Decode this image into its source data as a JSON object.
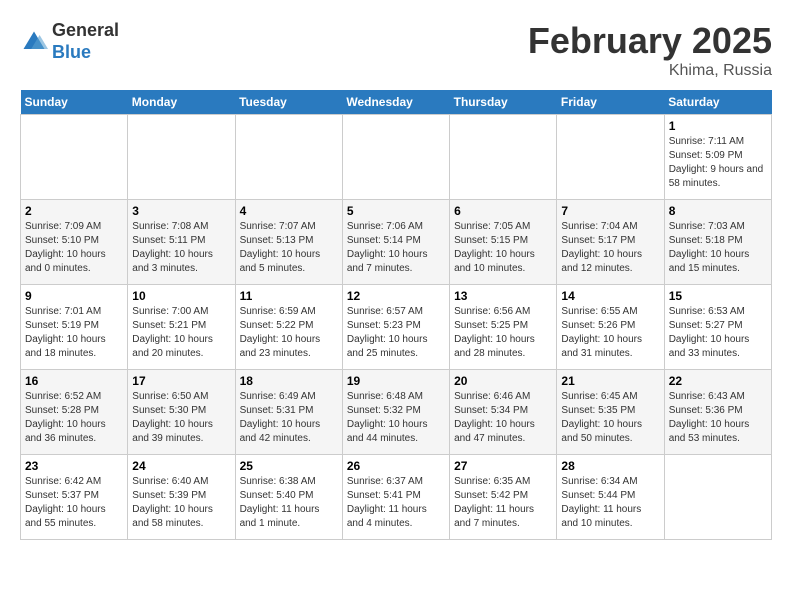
{
  "header": {
    "logo_general": "General",
    "logo_blue": "Blue",
    "title": "February 2025",
    "subtitle": "Khima, Russia"
  },
  "days_of_week": [
    "Sunday",
    "Monday",
    "Tuesday",
    "Wednesday",
    "Thursday",
    "Friday",
    "Saturday"
  ],
  "weeks": [
    [
      {
        "day": "",
        "info": ""
      },
      {
        "day": "",
        "info": ""
      },
      {
        "day": "",
        "info": ""
      },
      {
        "day": "",
        "info": ""
      },
      {
        "day": "",
        "info": ""
      },
      {
        "day": "",
        "info": ""
      },
      {
        "day": "1",
        "info": "Sunrise: 7:11 AM\nSunset: 5:09 PM\nDaylight: 9 hours and 58 minutes."
      }
    ],
    [
      {
        "day": "2",
        "info": "Sunrise: 7:09 AM\nSunset: 5:10 PM\nDaylight: 10 hours and 0 minutes."
      },
      {
        "day": "3",
        "info": "Sunrise: 7:08 AM\nSunset: 5:11 PM\nDaylight: 10 hours and 3 minutes."
      },
      {
        "day": "4",
        "info": "Sunrise: 7:07 AM\nSunset: 5:13 PM\nDaylight: 10 hours and 5 minutes."
      },
      {
        "day": "5",
        "info": "Sunrise: 7:06 AM\nSunset: 5:14 PM\nDaylight: 10 hours and 7 minutes."
      },
      {
        "day": "6",
        "info": "Sunrise: 7:05 AM\nSunset: 5:15 PM\nDaylight: 10 hours and 10 minutes."
      },
      {
        "day": "7",
        "info": "Sunrise: 7:04 AM\nSunset: 5:17 PM\nDaylight: 10 hours and 12 minutes."
      },
      {
        "day": "8",
        "info": "Sunrise: 7:03 AM\nSunset: 5:18 PM\nDaylight: 10 hours and 15 minutes."
      }
    ],
    [
      {
        "day": "9",
        "info": "Sunrise: 7:01 AM\nSunset: 5:19 PM\nDaylight: 10 hours and 18 minutes."
      },
      {
        "day": "10",
        "info": "Sunrise: 7:00 AM\nSunset: 5:21 PM\nDaylight: 10 hours and 20 minutes."
      },
      {
        "day": "11",
        "info": "Sunrise: 6:59 AM\nSunset: 5:22 PM\nDaylight: 10 hours and 23 minutes."
      },
      {
        "day": "12",
        "info": "Sunrise: 6:57 AM\nSunset: 5:23 PM\nDaylight: 10 hours and 25 minutes."
      },
      {
        "day": "13",
        "info": "Sunrise: 6:56 AM\nSunset: 5:25 PM\nDaylight: 10 hours and 28 minutes."
      },
      {
        "day": "14",
        "info": "Sunrise: 6:55 AM\nSunset: 5:26 PM\nDaylight: 10 hours and 31 minutes."
      },
      {
        "day": "15",
        "info": "Sunrise: 6:53 AM\nSunset: 5:27 PM\nDaylight: 10 hours and 33 minutes."
      }
    ],
    [
      {
        "day": "16",
        "info": "Sunrise: 6:52 AM\nSunset: 5:28 PM\nDaylight: 10 hours and 36 minutes."
      },
      {
        "day": "17",
        "info": "Sunrise: 6:50 AM\nSunset: 5:30 PM\nDaylight: 10 hours and 39 minutes."
      },
      {
        "day": "18",
        "info": "Sunrise: 6:49 AM\nSunset: 5:31 PM\nDaylight: 10 hours and 42 minutes."
      },
      {
        "day": "19",
        "info": "Sunrise: 6:48 AM\nSunset: 5:32 PM\nDaylight: 10 hours and 44 minutes."
      },
      {
        "day": "20",
        "info": "Sunrise: 6:46 AM\nSunset: 5:34 PM\nDaylight: 10 hours and 47 minutes."
      },
      {
        "day": "21",
        "info": "Sunrise: 6:45 AM\nSunset: 5:35 PM\nDaylight: 10 hours and 50 minutes."
      },
      {
        "day": "22",
        "info": "Sunrise: 6:43 AM\nSunset: 5:36 PM\nDaylight: 10 hours and 53 minutes."
      }
    ],
    [
      {
        "day": "23",
        "info": "Sunrise: 6:42 AM\nSunset: 5:37 PM\nDaylight: 10 hours and 55 minutes."
      },
      {
        "day": "24",
        "info": "Sunrise: 6:40 AM\nSunset: 5:39 PM\nDaylight: 10 hours and 58 minutes."
      },
      {
        "day": "25",
        "info": "Sunrise: 6:38 AM\nSunset: 5:40 PM\nDaylight: 11 hours and 1 minute."
      },
      {
        "day": "26",
        "info": "Sunrise: 6:37 AM\nSunset: 5:41 PM\nDaylight: 11 hours and 4 minutes."
      },
      {
        "day": "27",
        "info": "Sunrise: 6:35 AM\nSunset: 5:42 PM\nDaylight: 11 hours and 7 minutes."
      },
      {
        "day": "28",
        "info": "Sunrise: 6:34 AM\nSunset: 5:44 PM\nDaylight: 11 hours and 10 minutes."
      },
      {
        "day": "",
        "info": ""
      }
    ]
  ]
}
